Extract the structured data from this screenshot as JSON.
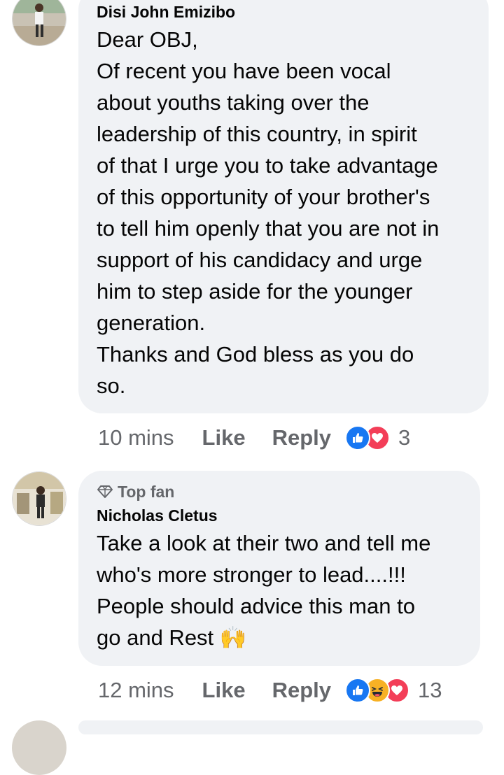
{
  "comments": [
    {
      "author": "Disi John Emizibo",
      "top_fan": "",
      "lines": [
        "Dear OBJ,",
        "Of recent you have been vocal",
        "about youths taking over the",
        "leadership of this country, in spirit",
        "of that I urge you to take advantage",
        "of this opportunity of your brother's",
        "to tell him openly that you are not in",
        "support of his candidacy and urge",
        "him to step aside for the younger",
        "generation.",
        "Thanks and God bless as you do",
        "so."
      ],
      "time": "10 mins",
      "like_label": "Like",
      "reply_label": "Reply",
      "reactions": [
        "like",
        "love"
      ],
      "reaction_count": "3"
    },
    {
      "author": "Nicholas Cletus",
      "top_fan": "Top fan",
      "lines": [
        "Take a look at their two and tell me",
        "who's more stronger to lead....!!!",
        "People should advice this man to",
        "go and Rest 🙌"
      ],
      "time": "12 mins",
      "like_label": "Like",
      "reply_label": "Reply",
      "reactions": [
        "like",
        "haha",
        "love"
      ],
      "reaction_count": "13"
    }
  ]
}
